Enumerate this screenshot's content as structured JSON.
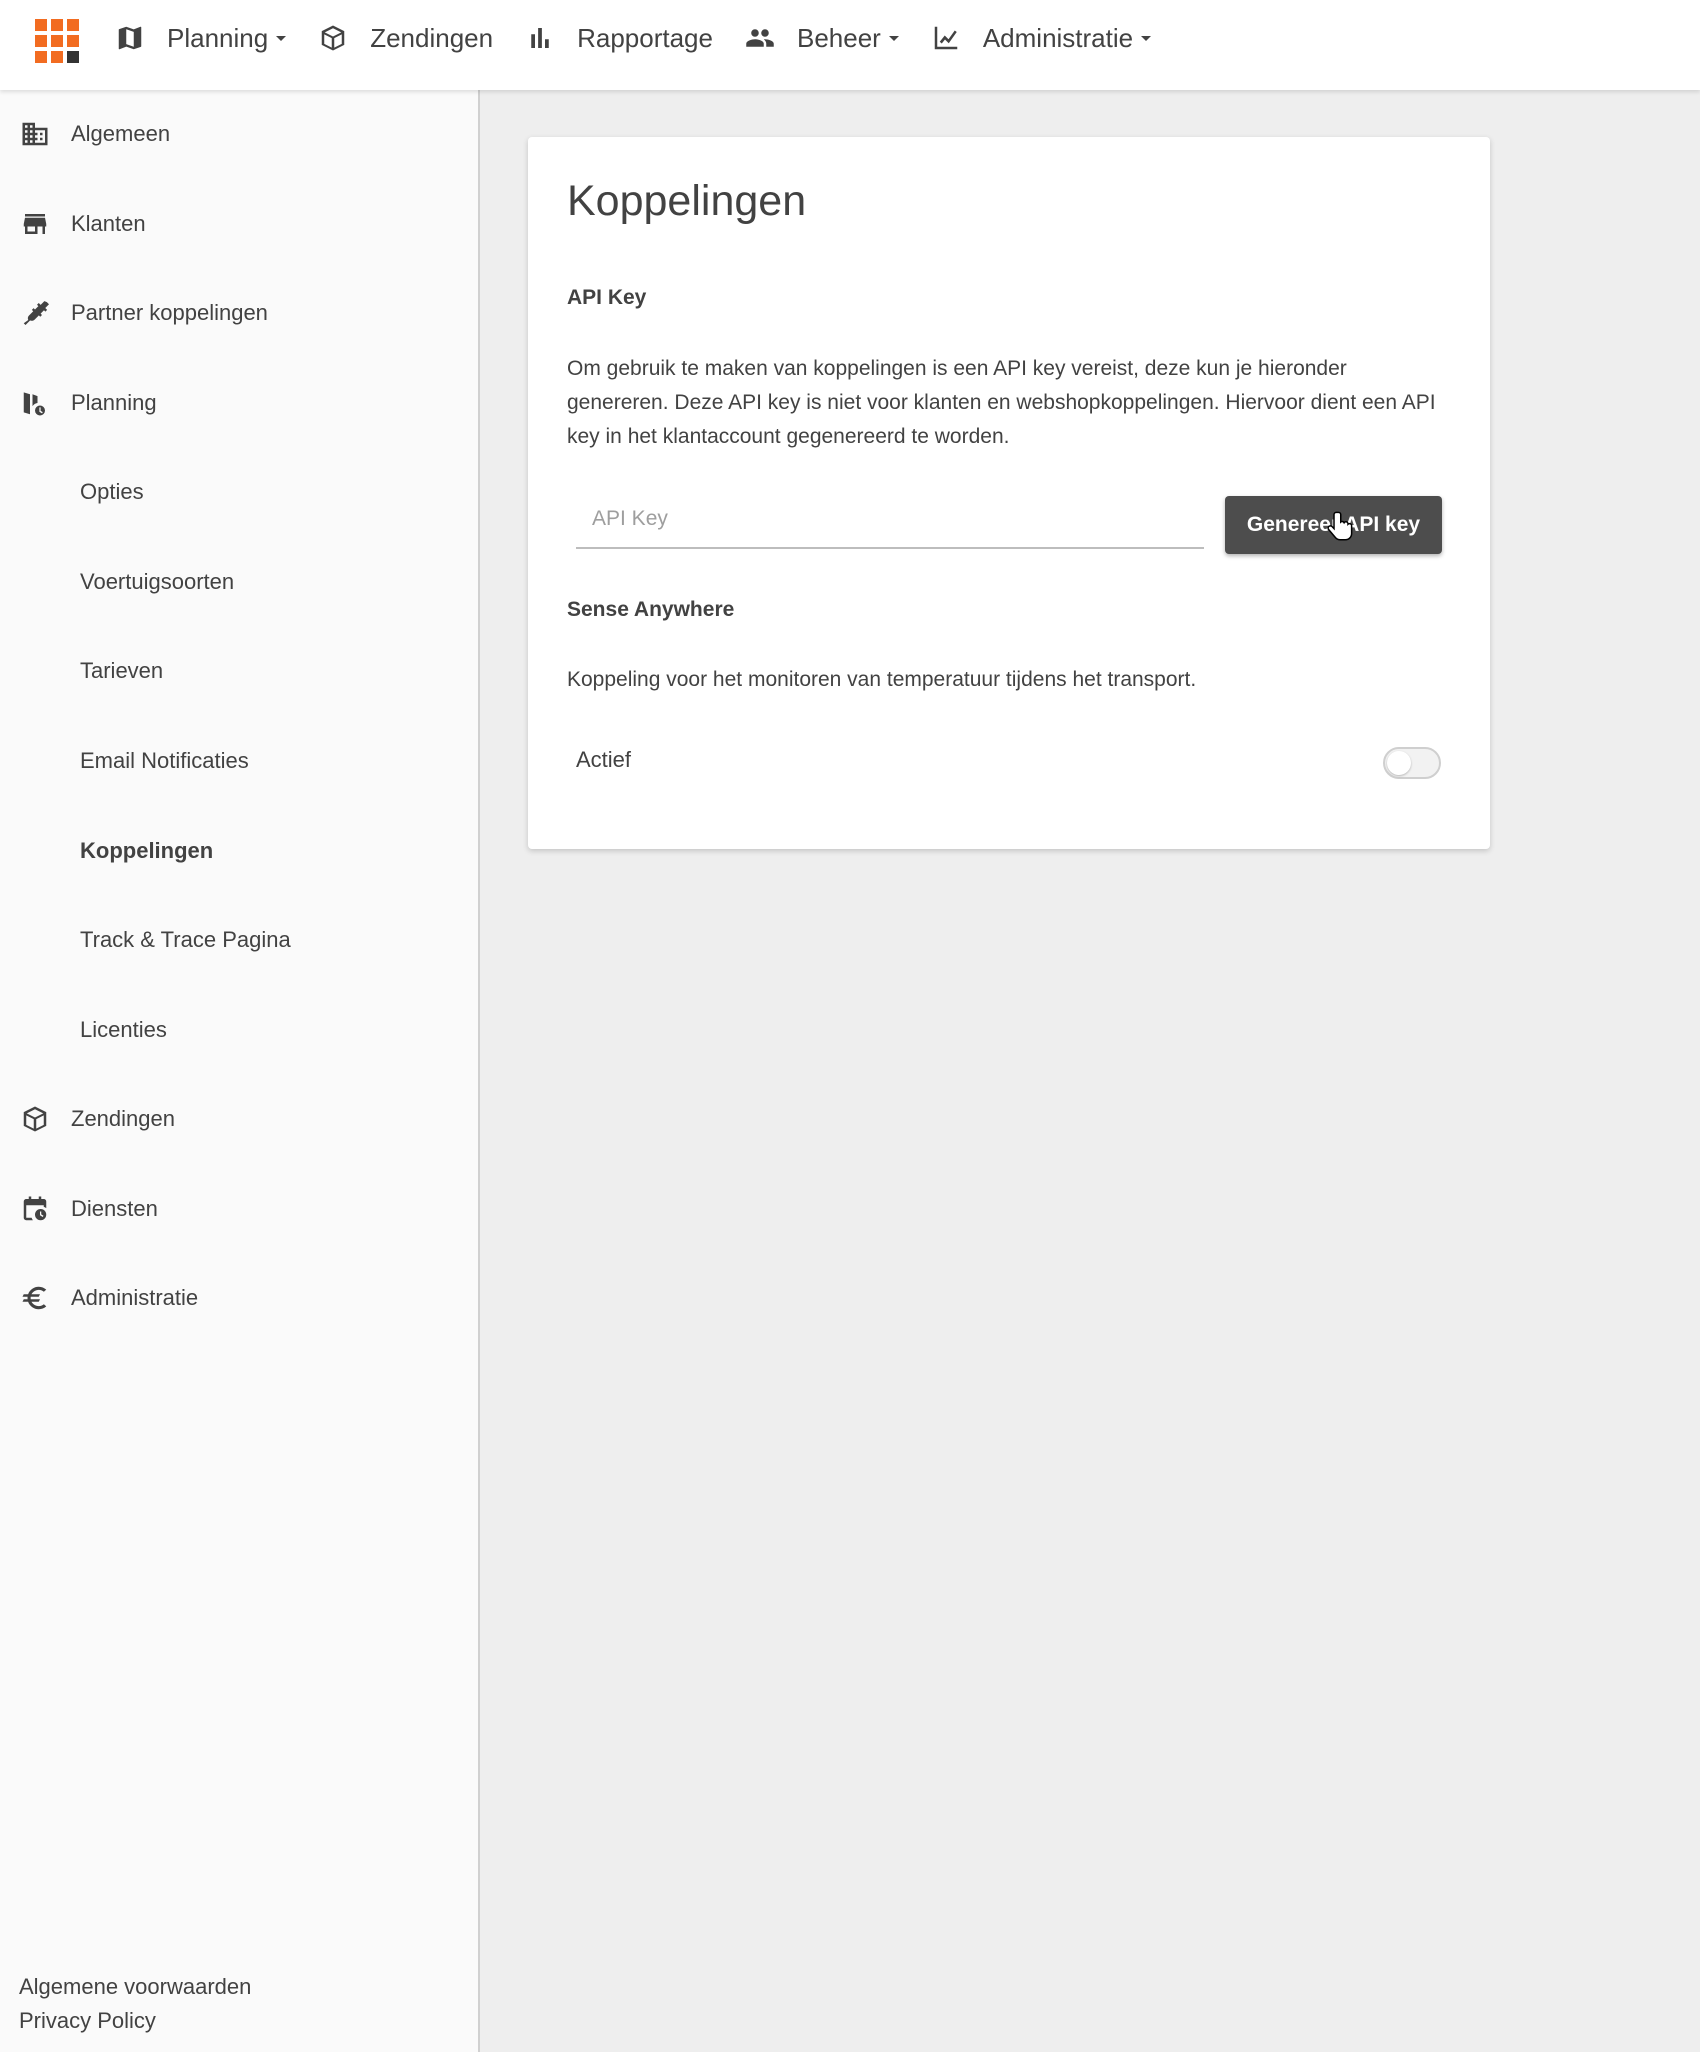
{
  "colors": {
    "accent": "#f26c21",
    "dark": "#333333",
    "button_bg": "#4d4d4d",
    "text": "#424242"
  },
  "logo": {
    "icon": "grid-logo-icon",
    "tiles": [
      "#f26c21",
      "#f26c21",
      "#f26c21",
      "#f26c21",
      "#f26c21",
      "#f26c21",
      "#f26c21",
      "#f26c21",
      "#333333"
    ]
  },
  "topnav": {
    "items": [
      {
        "label": "Planning",
        "icon": "map-icon",
        "dropdown": true
      },
      {
        "label": "Zendingen",
        "icon": "package-icon",
        "dropdown": false
      },
      {
        "label": "Rapportage",
        "icon": "bar-chart-icon",
        "dropdown": false
      },
      {
        "label": "Beheer",
        "icon": "people-icon",
        "dropdown": true
      },
      {
        "label": "Administratie",
        "icon": "chart-line-icon",
        "dropdown": true
      }
    ]
  },
  "sidebar": {
    "items": [
      {
        "label": "Algemeen",
        "icon": "building-icon"
      },
      {
        "label": "Klanten",
        "icon": "store-icon"
      },
      {
        "label": "Partner koppelingen",
        "icon": "plug-icon"
      },
      {
        "label": "Planning",
        "icon": "map-clock-icon"
      },
      {
        "label": "Opties"
      },
      {
        "label": "Voertuigsoorten"
      },
      {
        "label": "Tarieven"
      },
      {
        "label": "Email Notificaties"
      },
      {
        "label": "Koppelingen",
        "active": true
      },
      {
        "label": "Track & Trace Pagina"
      },
      {
        "label": "Licenties"
      },
      {
        "label": "Zendingen",
        "icon": "package-icon"
      },
      {
        "label": "Diensten",
        "icon": "calendar-clock-icon"
      },
      {
        "label": "Administratie",
        "icon": "euro-icon"
      }
    ],
    "footer": {
      "terms": "Algemene voorwaarden",
      "privacy": "Privacy Policy"
    }
  },
  "main": {
    "title": "Koppelingen",
    "api_key": {
      "heading": "API Key",
      "description": "Om gebruik te maken van koppelingen is een API key vereist, deze kun je hieronder genereren. Deze API key is niet voor klanten en webshopkoppelingen. Hiervoor dient een API key in het klantaccount gegenereerd te worden.",
      "input_placeholder": "API Key",
      "input_value": "",
      "button_label": "Genereer API key"
    },
    "sense": {
      "heading": "Sense Anywhere",
      "description": "Koppeling voor het monitoren van temperatuur tijdens het transport.",
      "toggle_label": "Actief",
      "toggle_on": false
    }
  }
}
